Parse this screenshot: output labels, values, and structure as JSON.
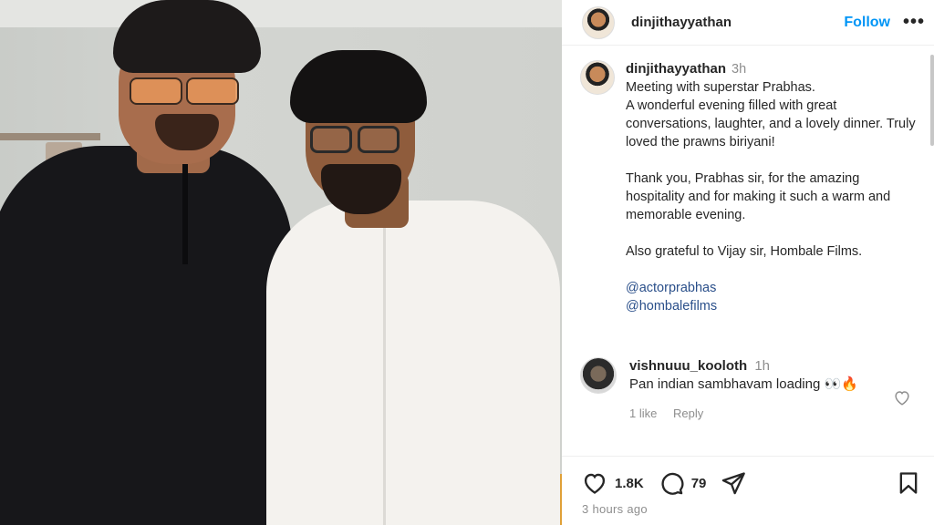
{
  "photo": {
    "description_icon": "photo"
  },
  "header": {
    "username": "dinjithayyathan",
    "follow_label": "Follow",
    "more_label": "•••"
  },
  "caption": {
    "username": "dinjithayyathan",
    "time": "3h",
    "paragraph1": "Meeting with superstar Prabhas.\nA wonderful evening filled with great conversations, laughter, and a lovely dinner. Truly loved the prawns biriyani!",
    "paragraph2": "Thank you, Prabhas sir, for the amazing hospitality and for making it such a warm and memorable evening.",
    "paragraph3": "Also grateful to Vijay sir, Hombale Films.",
    "mentions": [
      "@actorprabhas",
      "@hombalefilms"
    ]
  },
  "comment": {
    "username": "vishnuuu_kooloth",
    "time": "1h",
    "text": "Pan indian sambhavam loading 👀🔥",
    "likes": "1 like",
    "reply_label": "Reply"
  },
  "actions": {
    "like_count": "1.8K",
    "comment_count": "79",
    "posted": "3 hours ago"
  },
  "colors": {
    "accent": "#0095f6",
    "muted": "#8e8e8e",
    "text": "#262626"
  },
  "icons": [
    "heart-icon",
    "comment-icon",
    "share-icon",
    "bookmark-icon",
    "more-icon",
    "small-heart-icon"
  ]
}
